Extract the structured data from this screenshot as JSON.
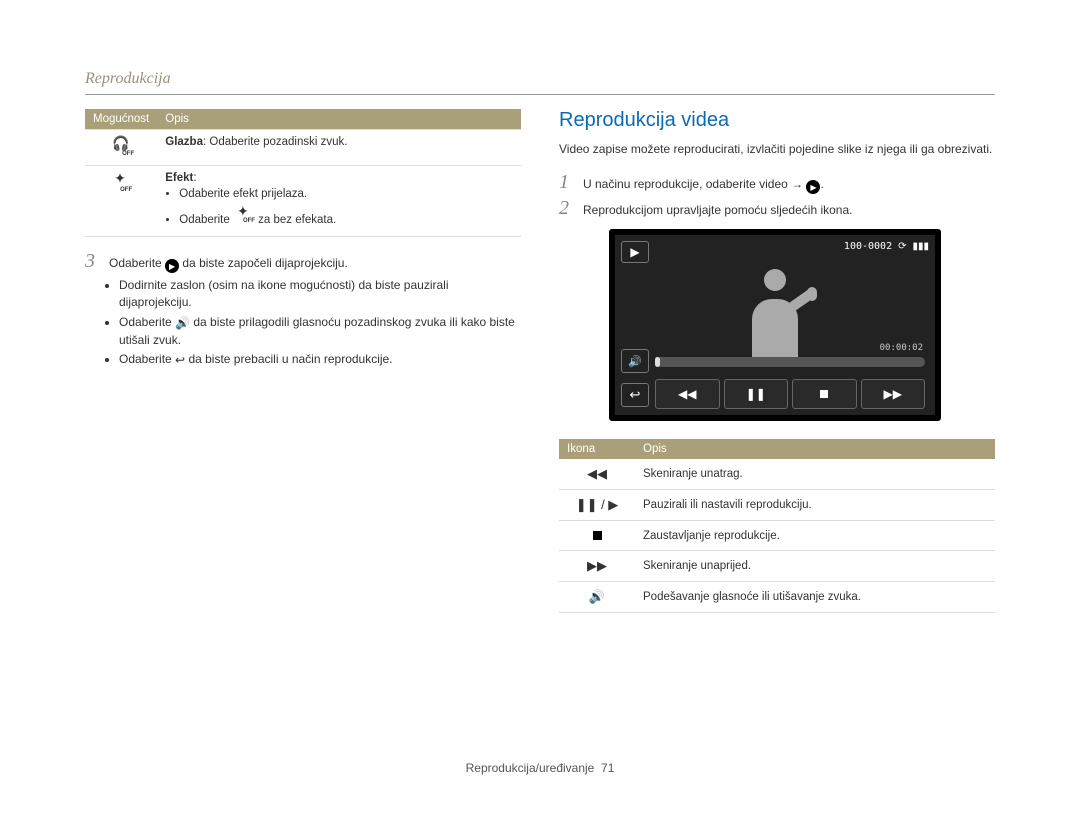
{
  "header": {
    "title": "Reprodukcija"
  },
  "leftCol": {
    "table": {
      "headers": [
        "Mogućnost",
        "Opis"
      ],
      "rows": [
        {
          "icon": "headphones-off-icon",
          "descStrong": "Glazba",
          "desc": ": Odaberite pozadinski zvuk."
        },
        {
          "icon": "sparkle-off-icon",
          "descStrong": "Efekt",
          "desc": ":",
          "bullets": [
            "Odaberite efekt prijelaza.",
            {
              "pre": "Odaberite ",
              "icon": "sparkle-off-icon",
              "post": " za bez efekata."
            }
          ]
        }
      ]
    },
    "step3": {
      "num": "3",
      "pre": "Odaberite ",
      "icon": "play-circle-icon",
      "post": " da biste započeli dijaprojekciju."
    },
    "bullets": [
      "Dodirnite zaslon (osim na ikone mogućnosti) da biste pauzirali dijaprojekciju.",
      {
        "pre": "Odaberite ",
        "icon": "volume-icon",
        "post": " da biste prilagodili glasnoću pozadinskog zvuka ili kako biste utišali zvuk."
      },
      {
        "pre": "Odaberite ",
        "icon": "back-arrow-icon",
        "post": " da biste prebacili u način reprodukcije."
      }
    ]
  },
  "rightCol": {
    "title": "Reprodukcija videa",
    "intro": "Video zapise možete reproducirati, izvlačiti pojedine slike iz njega ili ga obrezivati.",
    "steps": [
      {
        "num": "1",
        "pre": "U načinu reprodukcije, odaberite video → ",
        "icon": "play-circle-icon",
        "post": "."
      },
      {
        "num": "2",
        "text": "Reprodukcijom upravljajte pomoću sljedećih ikona."
      }
    ],
    "player": {
      "fileNo": "100-0002",
      "time": "00:00:02"
    },
    "iconTable": {
      "headers": [
        "Ikona",
        "Opis"
      ],
      "rows": [
        {
          "icon": "rewind-icon",
          "glyph": "◀◀",
          "desc": "Skeniranje unatrag."
        },
        {
          "icon": "pause-play-icon",
          "glyph": "❚❚ / ▶",
          "desc": "Pauzirali ili nastavili reprodukciju."
        },
        {
          "icon": "stop-icon",
          "glyph": "■",
          "desc": "Zaustavljanje reprodukcije."
        },
        {
          "icon": "fastforward-icon",
          "glyph": "▶▶",
          "desc": "Skeniranje unaprijed."
        },
        {
          "icon": "volume-icon",
          "glyph": "◀))",
          "desc": "Podešavanje glasnoće ili utišavanje zvuka."
        }
      ]
    }
  },
  "footer": {
    "section": "Reprodukcija/uređivanje",
    "page": "71"
  }
}
